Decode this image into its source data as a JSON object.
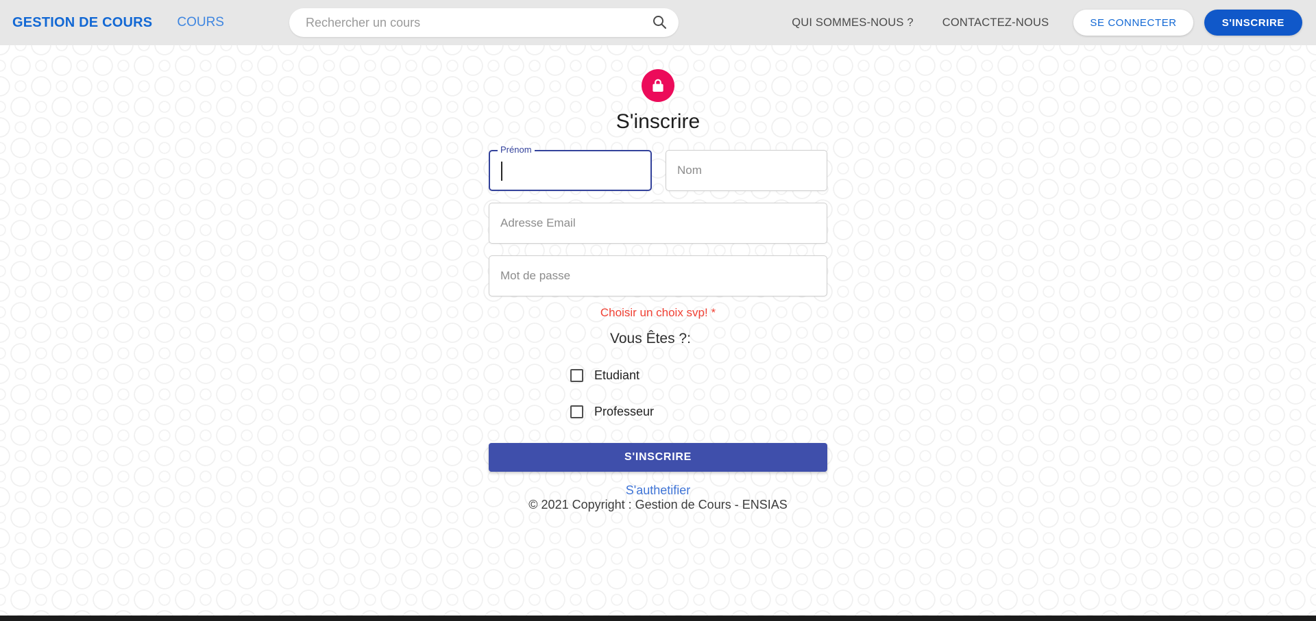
{
  "header": {
    "brand": "GESTION DE COURS",
    "nav_cours": "COURS",
    "search_placeholder": "Rechercher un cours",
    "search_value": "",
    "search_icon": "search-icon",
    "links": [
      {
        "label": "QUI SOMMES-NOUS ?"
      },
      {
        "label": "CONTACTEZ-NOUS"
      }
    ],
    "login_label": "SE CONNECTER",
    "signup_label": "S'INSCRIRE"
  },
  "main": {
    "lock_icon": "lock-icon",
    "title": "S'inscrire",
    "fields": {
      "firstname": {
        "label": "Prénom",
        "value": "",
        "placeholder": "Prénom",
        "focused": true
      },
      "lastname": {
        "placeholder": "Nom",
        "value": ""
      },
      "email": {
        "placeholder": "Adresse Email",
        "value": ""
      },
      "password": {
        "placeholder": "Mot de passe",
        "value": ""
      }
    },
    "error_message": "Choisir un choix svp!",
    "error_star": "*",
    "question": "Vous Êtes ?:",
    "choices": [
      {
        "label": "Etudiant",
        "checked": false
      },
      {
        "label": "Professeur",
        "checked": false
      }
    ],
    "submit_label": "S'INSCRIRE",
    "auth_link": "S'authetifier",
    "copyright": "© 2021 Copyright : Gestion de Cours - ENSIAS"
  },
  "colors": {
    "brand_blue": "#1268d4",
    "signup_blue": "#1058c9",
    "lock_pink": "#ec0b5a",
    "submit_indigo": "#3f4fab",
    "error_red": "#f04134",
    "focus_outline": "#33429b",
    "link_blue": "#3f74d6",
    "topbar_gray": "#e7e7e7"
  }
}
